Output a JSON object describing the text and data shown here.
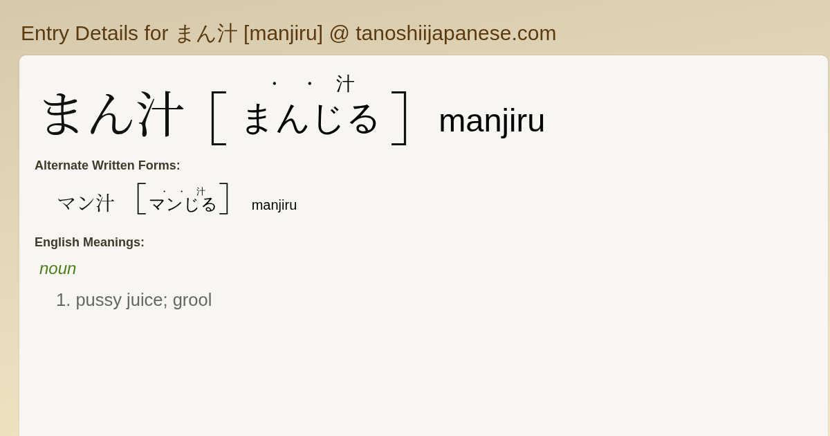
{
  "page_title": "Entry Details for まん汁 [manjiru] @ tanoshiijapanese.com",
  "entry": {
    "word": "まん汁",
    "bracket_open": "［",
    "reading": [
      {
        "kana": "ま",
        "ruby": "・"
      },
      {
        "kana": "ん",
        "ruby": "・"
      },
      {
        "kana": "じる",
        "ruby": "汁"
      }
    ],
    "bracket_close": "］",
    "romaji": "manjiru"
  },
  "alternate_forms": {
    "heading": "Alternate Written Forms:",
    "forms": [
      {
        "word": "マン汁",
        "bracket_open": "［",
        "reading": [
          {
            "kana": "マ",
            "ruby": "・"
          },
          {
            "kana": "ン",
            "ruby": "・"
          },
          {
            "kana": "じる",
            "ruby": "汁"
          }
        ],
        "bracket_close": "］",
        "romaji": "manjiru"
      }
    ]
  },
  "meanings": {
    "heading": "English Meanings:",
    "groups": [
      {
        "part_of_speech": "noun",
        "items": [
          {
            "number": "1.",
            "text": "pussy juice; grool"
          }
        ]
      }
    ]
  }
}
